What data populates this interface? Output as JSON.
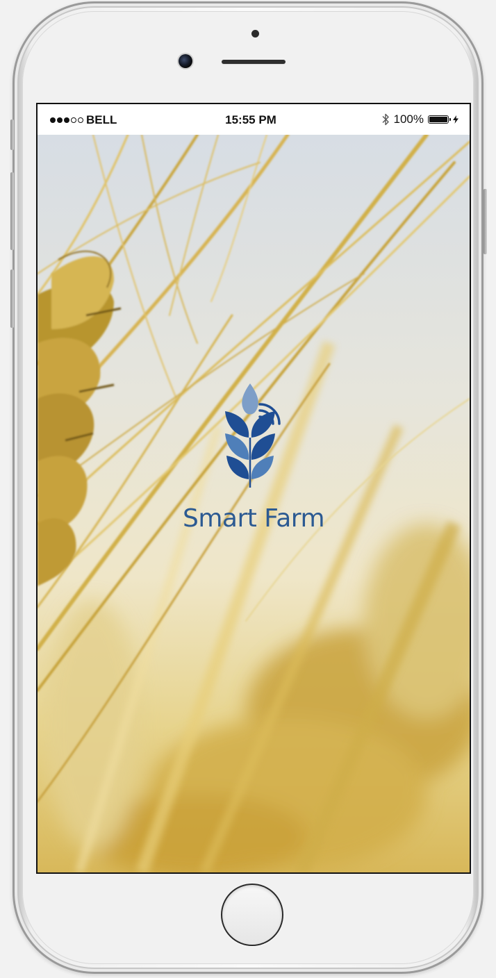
{
  "status_bar": {
    "carrier": "BELL",
    "signal_bars_full": 3,
    "signal_bars_total": 5,
    "time": "15:55 PM",
    "battery_percent_text": "100%",
    "battery_level": 1.0,
    "icons": [
      "signal-dots-icon",
      "bluetooth-icon",
      "battery-icon",
      "charging-bolt-icon"
    ]
  },
  "splash": {
    "app_name": "Smart Farm",
    "logo_icon": "wheat-wifi-logo-icon",
    "background": "wheat-field-photo"
  },
  "colors": {
    "brand_blue": "#2c5a92",
    "logo_dark": "#1f4e94",
    "logo_mid": "#4f7fb9",
    "logo_light": "#7d9ec8"
  },
  "device": {
    "home_button_icon": "home-button-icon"
  }
}
